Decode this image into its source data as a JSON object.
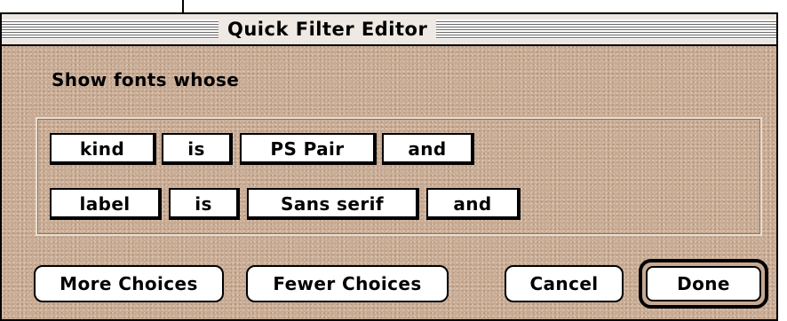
{
  "window": {
    "title": "Quick Filter Editor"
  },
  "prompt": "Show fonts whose",
  "criteria": [
    {
      "field": "kind",
      "operator": "is",
      "value": "PS Pair",
      "conjunction": "and"
    },
    {
      "field": "label",
      "operator": "is",
      "value": "Sans serif",
      "conjunction": "and"
    }
  ],
  "buttons": {
    "more": "More Choices",
    "fewer": "Fewer Choices",
    "cancel": "Cancel",
    "done": "Done"
  },
  "colors": {
    "background": "#c8aa92",
    "text": "#000000",
    "button_fill": "#ffffff"
  }
}
